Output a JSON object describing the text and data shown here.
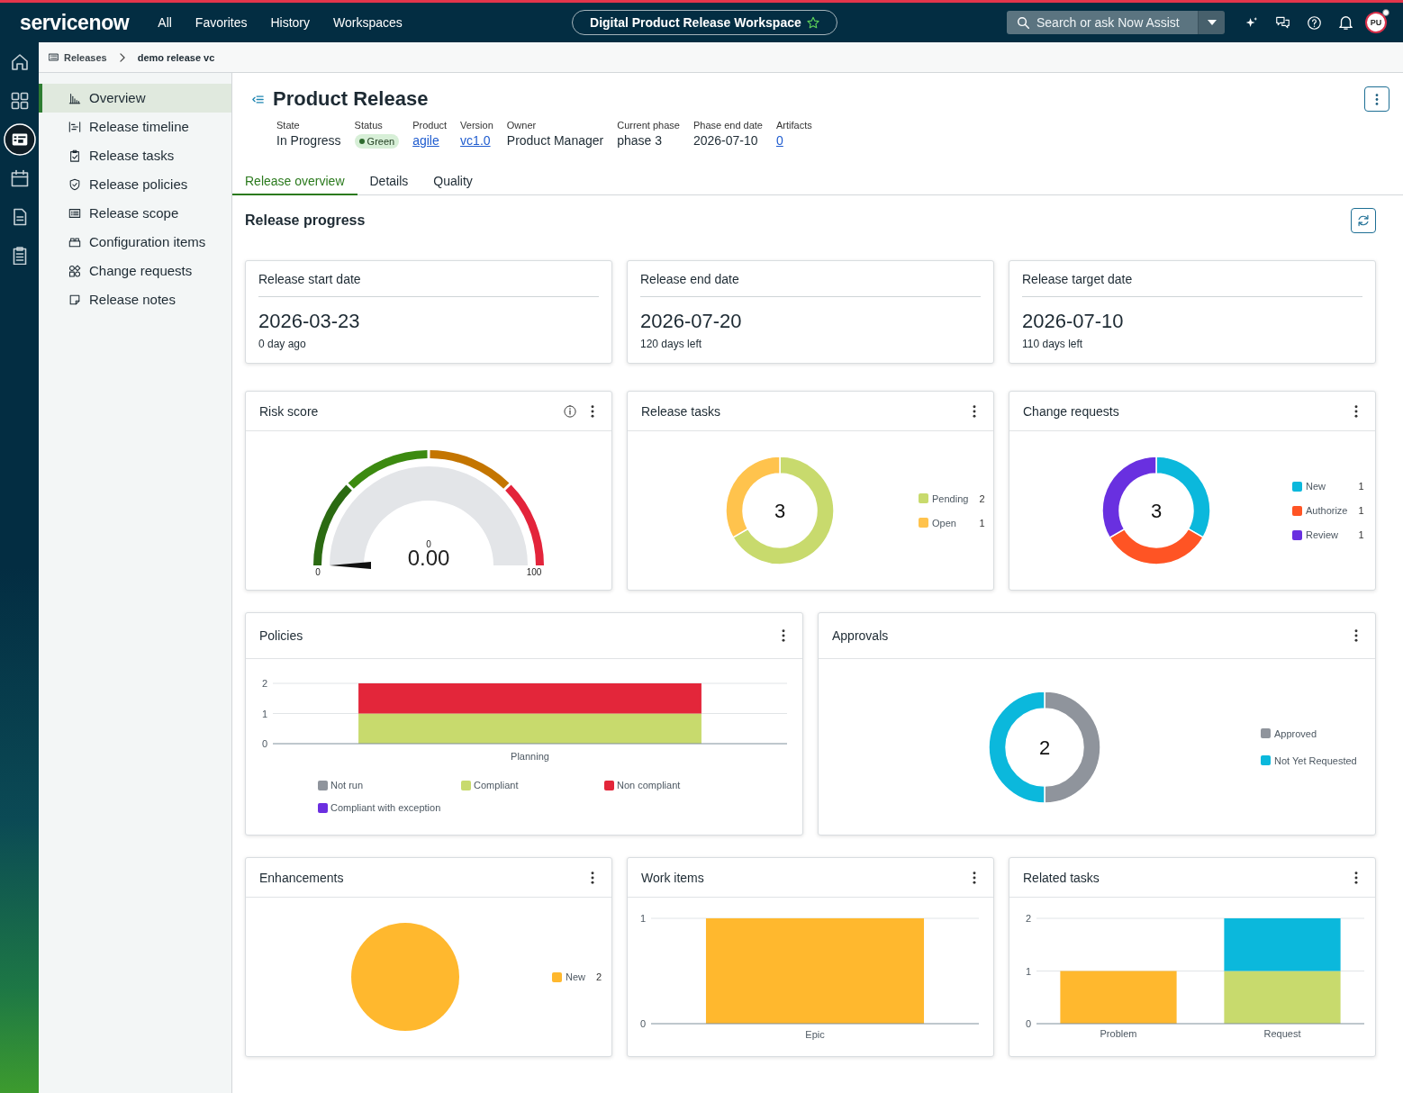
{
  "topbar": {
    "logo": "servicenow",
    "nav": [
      "All",
      "Favorites",
      "History",
      "Workspaces"
    ],
    "workspace": "Digital Product Release Workspace",
    "search": {
      "placeholder": "Search or ask Now Assist"
    },
    "avatar": "PU"
  },
  "rail": [
    {
      "selected": false
    },
    {
      "selected": false
    },
    {
      "selected": true
    },
    {
      "selected": false
    },
    {
      "selected": false
    },
    {
      "selected": false
    }
  ],
  "breadcrumb": [
    "Releases",
    "demo release vc"
  ],
  "sidebar": {
    "items": [
      {
        "label": "Overview",
        "selected": true
      },
      {
        "label": "Release timeline",
        "selected": false
      },
      {
        "label": "Release tasks",
        "selected": false
      },
      {
        "label": "Release policies",
        "selected": false
      },
      {
        "label": "Release scope",
        "selected": false
      },
      {
        "label": "Configuration items",
        "selected": false
      },
      {
        "label": "Change requests",
        "selected": false
      },
      {
        "label": "Release notes",
        "selected": false
      }
    ]
  },
  "header": {
    "title": "Product Release",
    "fields": [
      {
        "label": "State",
        "value": "In Progress",
        "kind": "text"
      },
      {
        "label": "Status",
        "value": "Green",
        "kind": "status"
      },
      {
        "label": "Product",
        "value": "agile",
        "kind": "link"
      },
      {
        "label": "Version",
        "value": "vc1.0",
        "kind": "link"
      },
      {
        "label": "Owner",
        "value": "Product Manager",
        "kind": "text"
      },
      {
        "label": "Current phase",
        "value": "phase 3",
        "kind": "text"
      },
      {
        "label": "Phase end date",
        "value": "2026-07-10",
        "kind": "text"
      },
      {
        "label": "Artifacts",
        "value": "0",
        "kind": "link"
      }
    ]
  },
  "tabs": [
    {
      "label": "Release overview",
      "selected": true
    },
    {
      "label": "Details",
      "selected": false
    },
    {
      "label": "Quality",
      "selected": false
    }
  ],
  "section_title": "Release progress",
  "date_cards": [
    {
      "title": "Release start date",
      "date": "2026-03-23",
      "note": "0 day ago"
    },
    {
      "title": "Release end date",
      "date": "2026-07-20",
      "note": "120 days left"
    },
    {
      "title": "Release target date",
      "date": "2026-07-10",
      "note": "110 days left"
    }
  ],
  "risk_score": {
    "title": "Risk score",
    "value": "0.00",
    "value_caption": "0",
    "min_label": "0",
    "max_label": "100"
  },
  "release_tasks": {
    "title": "Release tasks",
    "total": "3",
    "legend_items": [
      {
        "count": "2",
        "color": "#c8da6d"
      },
      {
        "count": "1",
        "color": "#ffc34d"
      }
    ],
    "chart_data": {
      "type": "donut",
      "categories": [
        "Pending",
        "Open"
      ],
      "values": [
        66.7,
        33.3
      ],
      "legend": "right"
    }
  },
  "change_requests": {
    "title": "Change requests",
    "total": "3",
    "legend_items": [
      {
        "count": "1",
        "color": "#0bb8dc"
      },
      {
        "count": "1",
        "color": "#ff5424"
      },
      {
        "count": "1",
        "color": "#6930e0"
      }
    ],
    "chart_data": {
      "type": "donut",
      "categories": [
        "New",
        "Authorize",
        "Review"
      ],
      "values": [
        33.3,
        33.3,
        33.4
      ],
      "legend": "right"
    }
  },
  "policies": {
    "title": "Policies",
    "chart_data": {
      "type": "bar",
      "categories": [
        "Planning"
      ],
      "series": [
        {
          "name": "Not run",
          "color": "#8f949c",
          "values": [
            0
          ]
        },
        {
          "name": "Compliant",
          "color": "#c8da6d",
          "values": [
            1
          ]
        },
        {
          "name": "Non compliant",
          "color": "#e3263a",
          "values": [
            1
          ]
        },
        {
          "name": "Compliant with exception",
          "color": "#6b2fe0",
          "values": [
            0
          ]
        }
      ],
      "yticks": [
        0,
        1,
        2
      ],
      "ylim": [
        0,
        2
      ],
      "stacked": true,
      "legend": "bottom"
    }
  },
  "approvals": {
    "title": "Approvals",
    "total": "2",
    "legend_items": [
      {
        "color": "#8f949c"
      },
      {
        "color": "#0bb8dc"
      }
    ],
    "chart_data": {
      "type": "donut",
      "categories": [
        "Approved",
        "Not Yet Requested"
      ],
      "values": [
        50,
        50
      ],
      "legend": "right"
    }
  },
  "enhancements": {
    "title": "Enhancements",
    "legend_items": [
      {
        "count": "2",
        "color": "#ffb82e"
      }
    ],
    "chart_data": {
      "type": "pie",
      "categories": [
        "New"
      ],
      "values": [
        100
      ],
      "legend": "right"
    }
  },
  "work_items": {
    "title": "Work items",
    "chart_data": {
      "type": "bar",
      "categories": [
        "Epic"
      ],
      "series": [
        {
          "color": "#ffb82e",
          "values": [
            1
          ]
        }
      ],
      "yticks": [
        0,
        1
      ],
      "ylim": [
        0,
        1
      ]
    }
  },
  "related_tasks": {
    "title": "Related tasks",
    "chart_data": {
      "type": "bar",
      "categories": [
        "Problem",
        "Request"
      ],
      "series": [
        {
          "color": "#ffb82e",
          "values": [
            1,
            0
          ]
        },
        {
          "color": "#c8da6d",
          "values": [
            0,
            1
          ]
        },
        {
          "color": "#0bb8dc",
          "values": [
            0,
            1
          ]
        }
      ],
      "yticks": [
        0,
        1,
        2
      ],
      "ylim": [
        0,
        2
      ],
      "stacked": true
    }
  }
}
